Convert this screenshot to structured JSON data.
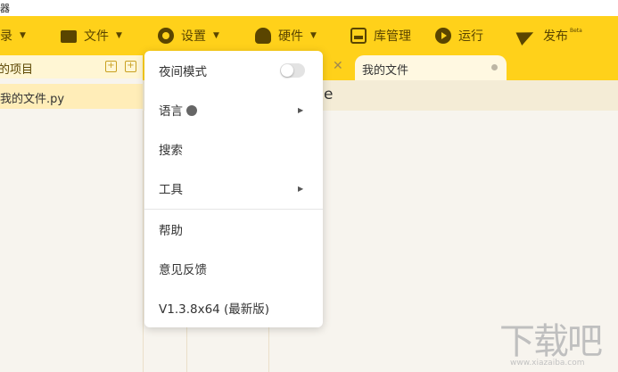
{
  "title_fragment": "器",
  "menubar": {
    "items": [
      {
        "label": "录",
        "icon": "folder-open-icon"
      },
      {
        "label": "文件",
        "icon": "folder-icon"
      },
      {
        "label": "设置",
        "icon": "gear-icon"
      },
      {
        "label": "硬件",
        "icon": "hardware-icon"
      },
      {
        "label": "库管理",
        "icon": "library-icon"
      },
      {
        "label": "运行",
        "icon": "run-icon"
      },
      {
        "label": "发布",
        "icon": "send-icon",
        "superscript": "Beta"
      }
    ]
  },
  "project_panel": {
    "title": "的项目",
    "files": [
      "我的文件.py"
    ]
  },
  "editor": {
    "active_tab": "我的文件",
    "code_fragment": "e"
  },
  "settings_menu": {
    "items": [
      {
        "label": "夜间模式",
        "type": "toggle",
        "checked": false
      },
      {
        "label": "语言",
        "type": "submenu",
        "icon": "globe-icon"
      },
      {
        "label": "搜索",
        "type": "item"
      },
      {
        "label": "工具",
        "type": "submenu"
      },
      {
        "label": "帮助",
        "type": "item"
      },
      {
        "label": "意见反馈",
        "type": "item"
      },
      {
        "label": "V1.3.8x64 (最新版)",
        "type": "version"
      }
    ]
  },
  "watermark": {
    "text": "下载吧",
    "url_text": "www.xiazaiba.com"
  },
  "colors": {
    "accent": "#ffd11a",
    "menu_text": "#5a4500",
    "panel_bg": "#f7f4ee",
    "selected_row": "#ffedb8"
  }
}
